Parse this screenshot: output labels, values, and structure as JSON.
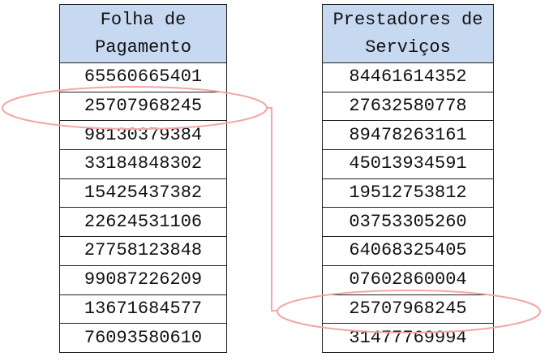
{
  "tables": [
    {
      "header": "Folha de Pagamento",
      "rows": [
        "65560665401",
        "25707968245",
        "98130379384",
        "33184848302",
        "15425437382",
        "22624531106",
        "27758123848",
        "99087226209",
        "13671684577",
        "76093580610"
      ]
    },
    {
      "header": "Prestadores de Serviços",
      "rows": [
        "84461614352",
        "27632580778",
        "89478263161",
        "45013934591",
        "19512753812",
        "03753305260",
        "64068325405",
        "07602860004",
        "25707968245",
        "31477769994"
      ]
    }
  ],
  "highlight": {
    "value": "25707968245",
    "left_row_index": 1,
    "right_row_index": 8,
    "color": "#f4a6a6"
  },
  "colors": {
    "header_bg": "#c6d9f1",
    "border": "#1f1f1f"
  }
}
